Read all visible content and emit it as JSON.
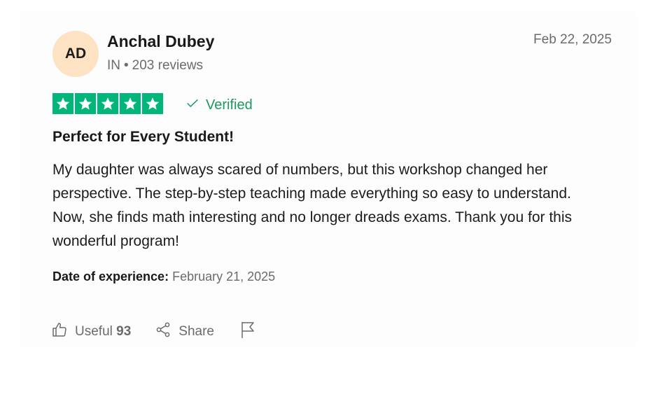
{
  "reviewer": {
    "initials": "AD",
    "name": "Anchal Dubey",
    "country": "IN",
    "separator": "•",
    "reviews": "203 reviews"
  },
  "review_date": "Feb 22, 2025",
  "rating": {
    "stars": 5,
    "max": 5,
    "color": "#00b67a"
  },
  "verified_label": "Verified",
  "review_title": "Perfect for Every Student!",
  "review_body": "My daughter was always scared of numbers, but this workshop changed her perspective. The step-by-step teaching made everything so easy to understand. Now, she finds math interesting and no longer dreads exams. Thank you for this wonderful program!",
  "experience": {
    "label": "Date of experience:",
    "value": "February 21, 2025"
  },
  "actions": {
    "useful_label": "Useful",
    "useful_count": "93",
    "share_label": "Share"
  },
  "icons": {
    "like": "thumbs-up-icon",
    "share": "share-icon",
    "flag": "flag-icon",
    "check": "check-icon",
    "star": "star-icon"
  }
}
